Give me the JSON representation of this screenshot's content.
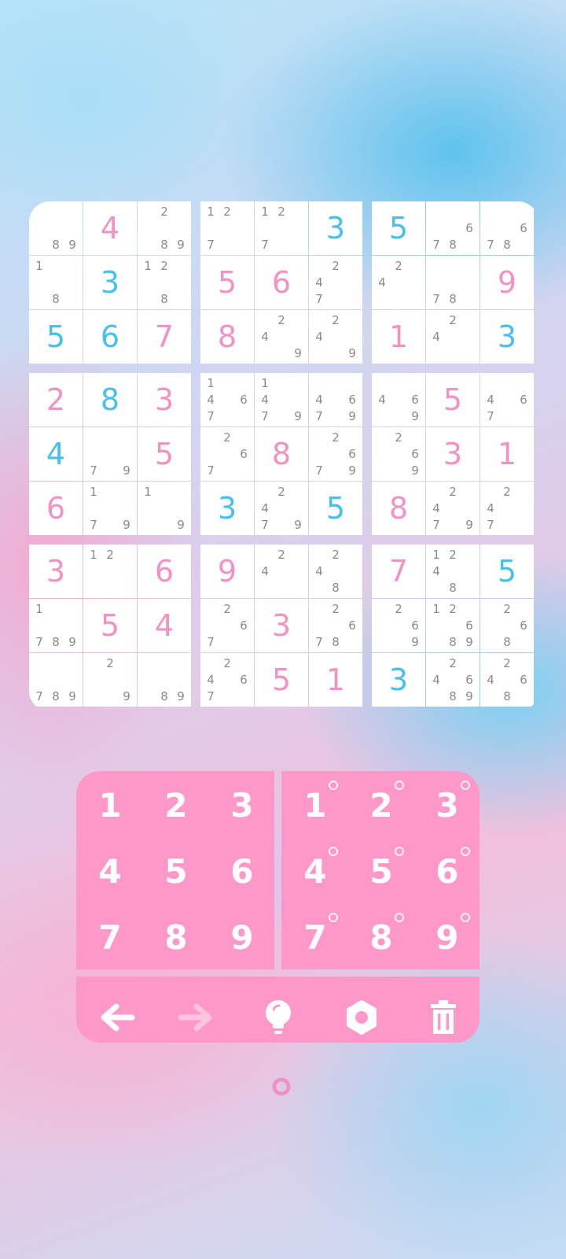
{
  "board": {
    "cells": [
      [
        {
          "v": "",
          "t": "",
          "n": [
            8,
            9
          ]
        },
        {
          "v": "4",
          "t": "user",
          "n": []
        },
        {
          "v": "",
          "t": "",
          "n": [
            2,
            8,
            9
          ]
        },
        {
          "v": "",
          "t": "",
          "n": [
            1,
            2,
            7
          ]
        },
        {
          "v": "",
          "t": "",
          "n": [
            1,
            2,
            7
          ]
        },
        {
          "v": "3",
          "t": "given",
          "n": []
        },
        {
          "v": "5",
          "t": "given",
          "n": []
        },
        {
          "v": "",
          "t": "",
          "n": [
            6,
            7,
            8
          ]
        },
        {
          "v": "",
          "t": "",
          "n": [
            6,
            7,
            8
          ]
        }
      ],
      [
        {
          "v": "",
          "t": "",
          "n": [
            1,
            8
          ]
        },
        {
          "v": "3",
          "t": "given",
          "n": []
        },
        {
          "v": "",
          "t": "",
          "n": [
            1,
            2,
            8
          ]
        },
        {
          "v": "5",
          "t": "user",
          "n": []
        },
        {
          "v": "6",
          "t": "user",
          "n": []
        },
        {
          "v": "",
          "t": "",
          "n": [
            2,
            4,
            7
          ]
        },
        {
          "v": "",
          "t": "",
          "n": [
            2,
            4
          ]
        },
        {
          "v": "",
          "t": "",
          "n": [
            7,
            8
          ]
        },
        {
          "v": "9",
          "t": "user",
          "n": []
        }
      ],
      [
        {
          "v": "5",
          "t": "given",
          "n": []
        },
        {
          "v": "6",
          "t": "given",
          "n": []
        },
        {
          "v": "7",
          "t": "user",
          "n": []
        },
        {
          "v": "8",
          "t": "user",
          "n": []
        },
        {
          "v": "",
          "t": "",
          "n": [
            2,
            4,
            9
          ]
        },
        {
          "v": "",
          "t": "",
          "n": [
            2,
            4,
            9
          ]
        },
        {
          "v": "1",
          "t": "user",
          "n": []
        },
        {
          "v": "",
          "t": "",
          "n": [
            2,
            4
          ]
        },
        {
          "v": "3",
          "t": "given",
          "n": []
        }
      ],
      [
        {
          "v": "2",
          "t": "user",
          "n": []
        },
        {
          "v": "8",
          "t": "given",
          "n": []
        },
        {
          "v": "3",
          "t": "user",
          "n": []
        },
        {
          "v": "",
          "t": "",
          "n": [
            1,
            4,
            6,
            7
          ]
        },
        {
          "v": "",
          "t": "",
          "n": [
            1,
            4,
            7,
            9
          ]
        },
        {
          "v": "",
          "t": "",
          "n": [
            4,
            6,
            7,
            9
          ]
        },
        {
          "v": "",
          "t": "",
          "n": [
            4,
            6,
            9
          ]
        },
        {
          "v": "5",
          "t": "user",
          "n": []
        },
        {
          "v": "",
          "t": "",
          "n": [
            4,
            6,
            7
          ]
        }
      ],
      [
        {
          "v": "4",
          "t": "given",
          "n": []
        },
        {
          "v": "",
          "t": "",
          "n": [
            7,
            9
          ]
        },
        {
          "v": "5",
          "t": "user",
          "n": []
        },
        {
          "v": "",
          "t": "",
          "n": [
            2,
            6,
            7
          ]
        },
        {
          "v": "8",
          "t": "user",
          "n": []
        },
        {
          "v": "",
          "t": "",
          "n": [
            2,
            6,
            7,
            9
          ]
        },
        {
          "v": "",
          "t": "",
          "n": [
            2,
            6,
            9
          ]
        },
        {
          "v": "3",
          "t": "user",
          "n": []
        },
        {
          "v": "1",
          "t": "user",
          "n": []
        }
      ],
      [
        {
          "v": "6",
          "t": "user",
          "n": []
        },
        {
          "v": "",
          "t": "",
          "n": [
            1,
            7,
            9
          ]
        },
        {
          "v": "",
          "t": "",
          "n": [
            1,
            9
          ]
        },
        {
          "v": "3",
          "t": "given",
          "n": []
        },
        {
          "v": "",
          "t": "",
          "n": [
            2,
            4,
            7,
            9
          ]
        },
        {
          "v": "5",
          "t": "given",
          "n": []
        },
        {
          "v": "8",
          "t": "user",
          "n": []
        },
        {
          "v": "",
          "t": "",
          "n": [
            2,
            4,
            7,
            9
          ]
        },
        {
          "v": "",
          "t": "",
          "n": [
            2,
            4,
            7
          ]
        }
      ],
      [
        {
          "v": "3",
          "t": "user",
          "n": []
        },
        {
          "v": "",
          "t": "",
          "n": [
            1,
            2
          ]
        },
        {
          "v": "6",
          "t": "user",
          "n": []
        },
        {
          "v": "9",
          "t": "user",
          "n": []
        },
        {
          "v": "",
          "t": "",
          "n": [
            2,
            4
          ]
        },
        {
          "v": "",
          "t": "",
          "n": [
            2,
            4,
            8
          ]
        },
        {
          "v": "7",
          "t": "user",
          "n": []
        },
        {
          "v": "",
          "t": "",
          "n": [
            1,
            2,
            4,
            8
          ]
        },
        {
          "v": "5",
          "t": "given",
          "n": []
        }
      ],
      [
        {
          "v": "",
          "t": "",
          "n": [
            1,
            7,
            8,
            9
          ]
        },
        {
          "v": "5",
          "t": "user",
          "n": []
        },
        {
          "v": "4",
          "t": "user",
          "n": []
        },
        {
          "v": "",
          "t": "",
          "n": [
            2,
            6,
            7
          ]
        },
        {
          "v": "3",
          "t": "user",
          "n": []
        },
        {
          "v": "",
          "t": "",
          "n": [
            2,
            6,
            7,
            8
          ]
        },
        {
          "v": "",
          "t": "",
          "n": [
            2,
            6,
            9
          ]
        },
        {
          "v": "",
          "t": "",
          "n": [
            1,
            2,
            6,
            8,
            9
          ]
        },
        {
          "v": "",
          "t": "",
          "n": [
            2,
            6,
            8
          ]
        }
      ],
      [
        {
          "v": "",
          "t": "",
          "n": [
            7,
            8,
            9
          ]
        },
        {
          "v": "",
          "t": "",
          "n": [
            2,
            9
          ]
        },
        {
          "v": "",
          "t": "",
          "n": [
            8,
            9
          ]
        },
        {
          "v": "",
          "t": "",
          "n": [
            2,
            4,
            6,
            7
          ]
        },
        {
          "v": "5",
          "t": "user",
          "n": []
        },
        {
          "v": "1",
          "t": "user",
          "n": []
        },
        {
          "v": "3",
          "t": "given",
          "n": []
        },
        {
          "v": "",
          "t": "",
          "n": [
            2,
            4,
            6,
            8,
            9
          ]
        },
        {
          "v": "",
          "t": "",
          "n": [
            2,
            4,
            6,
            8
          ]
        }
      ]
    ]
  },
  "numpad": {
    "digits": [
      "1",
      "2",
      "3",
      "4",
      "5",
      "6",
      "7",
      "8",
      "9"
    ],
    "notes": [
      "1",
      "2",
      "3",
      "4",
      "5",
      "6",
      "7",
      "8",
      "9"
    ]
  },
  "toolbar": {
    "icons": [
      "undo-arrow-icon",
      "redo-arrow-icon",
      "hint-bulb-icon",
      "settings-gear-icon",
      "trash-icon"
    ]
  },
  "colors": {
    "given": "#45c1ec",
    "user": "#f292c4",
    "pad": "#fd98c9",
    "note": "#8a8a8a"
  }
}
